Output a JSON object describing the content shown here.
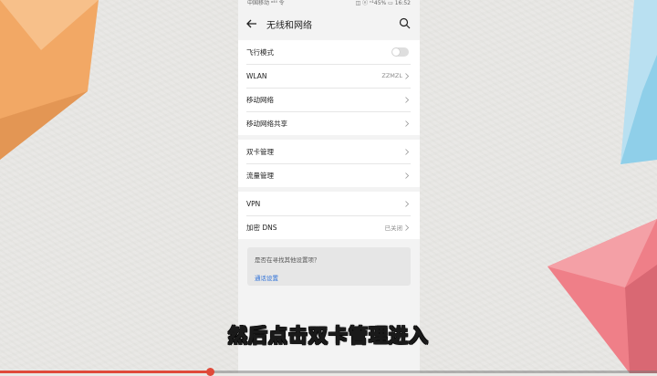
{
  "statusbar": {
    "left": "中国移动 ᵃ⁴ⁱˡ 令",
    "right": "◫ ⓝ ⁿ¹45% ▭ 16:52"
  },
  "header": {
    "title": "无线和网络"
  },
  "group1": [
    {
      "label": "飞行模式",
      "type": "toggle",
      "on": false
    },
    {
      "label": "WLAN",
      "value": "ZZMZL"
    },
    {
      "label": "移动网络",
      "value": ""
    },
    {
      "label": "移动网络共享",
      "value": ""
    }
  ],
  "group2": [
    {
      "label": "双卡管理",
      "value": ""
    },
    {
      "label": "流量管理",
      "value": ""
    }
  ],
  "group3": [
    {
      "label": "VPN",
      "value": ""
    },
    {
      "label": "加密 DNS",
      "value": "已关闭"
    }
  ],
  "card": {
    "question": "是否在寻找其他设置项？",
    "link": "通话设置"
  },
  "subtitle": "然后点击双卡管理进入",
  "video": {
    "progress": 0.32
  },
  "colors": {
    "accent": "#2b6fd8",
    "progress": "#e04a3a"
  }
}
